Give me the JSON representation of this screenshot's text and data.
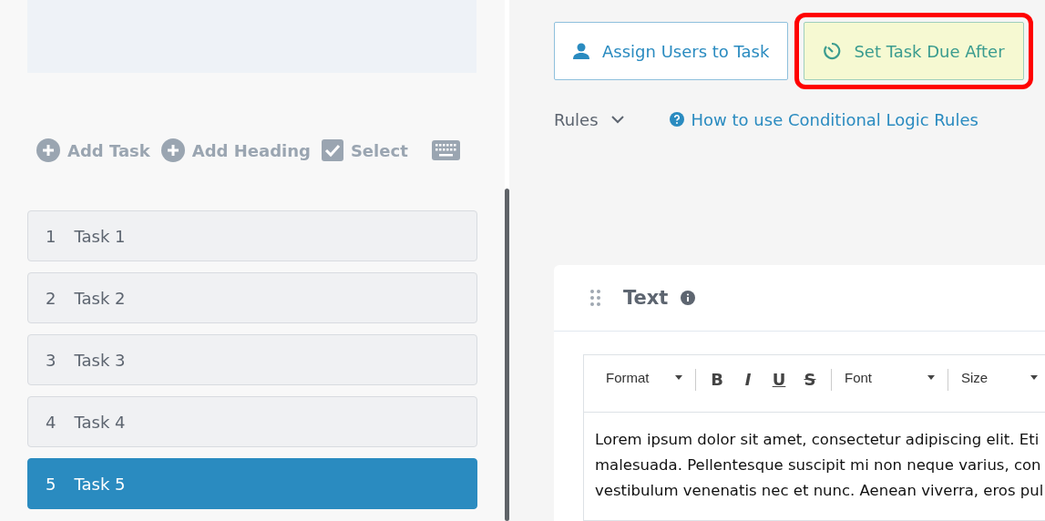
{
  "toolbar": [
    {
      "kind": "plus",
      "label": "Add Task"
    },
    {
      "kind": "plus",
      "label": "Add Heading"
    },
    {
      "kind": "check",
      "label": "Select"
    },
    {
      "kind": "keyboard"
    }
  ],
  "tasks": [
    {
      "number": "1",
      "label": "Task 1",
      "selected": false
    },
    {
      "number": "2",
      "label": "Task 2",
      "selected": false
    },
    {
      "number": "3",
      "label": "Task 3",
      "selected": false
    },
    {
      "number": "4",
      "label": "Task 4",
      "selected": false
    },
    {
      "number": "5",
      "label": "Task 5",
      "selected": true
    }
  ],
  "actions": [
    {
      "kind": "user",
      "label": "Assign Users to Task",
      "highlighted": false
    },
    {
      "kind": "timer",
      "label": "Set Task Due After",
      "highlighted": true
    }
  ],
  "rules": {
    "label": "Rules",
    "help_link": "How to use Conditional Logic Rules"
  },
  "card": {
    "title": "Text",
    "editor": {
      "format": "Format",
      "font": "Font",
      "size": "Size",
      "buttons": [
        "B",
        "I",
        "U",
        "S"
      ],
      "lines": [
        "Lorem ipsum dolor sit amet, consectetur adipiscing elit. Eti",
        "malesuada. Pellentesque suscipit mi non neque varius, con",
        "vestibulum venenatis nec et nunc. Aenean viverra, eros pul"
      ]
    }
  }
}
